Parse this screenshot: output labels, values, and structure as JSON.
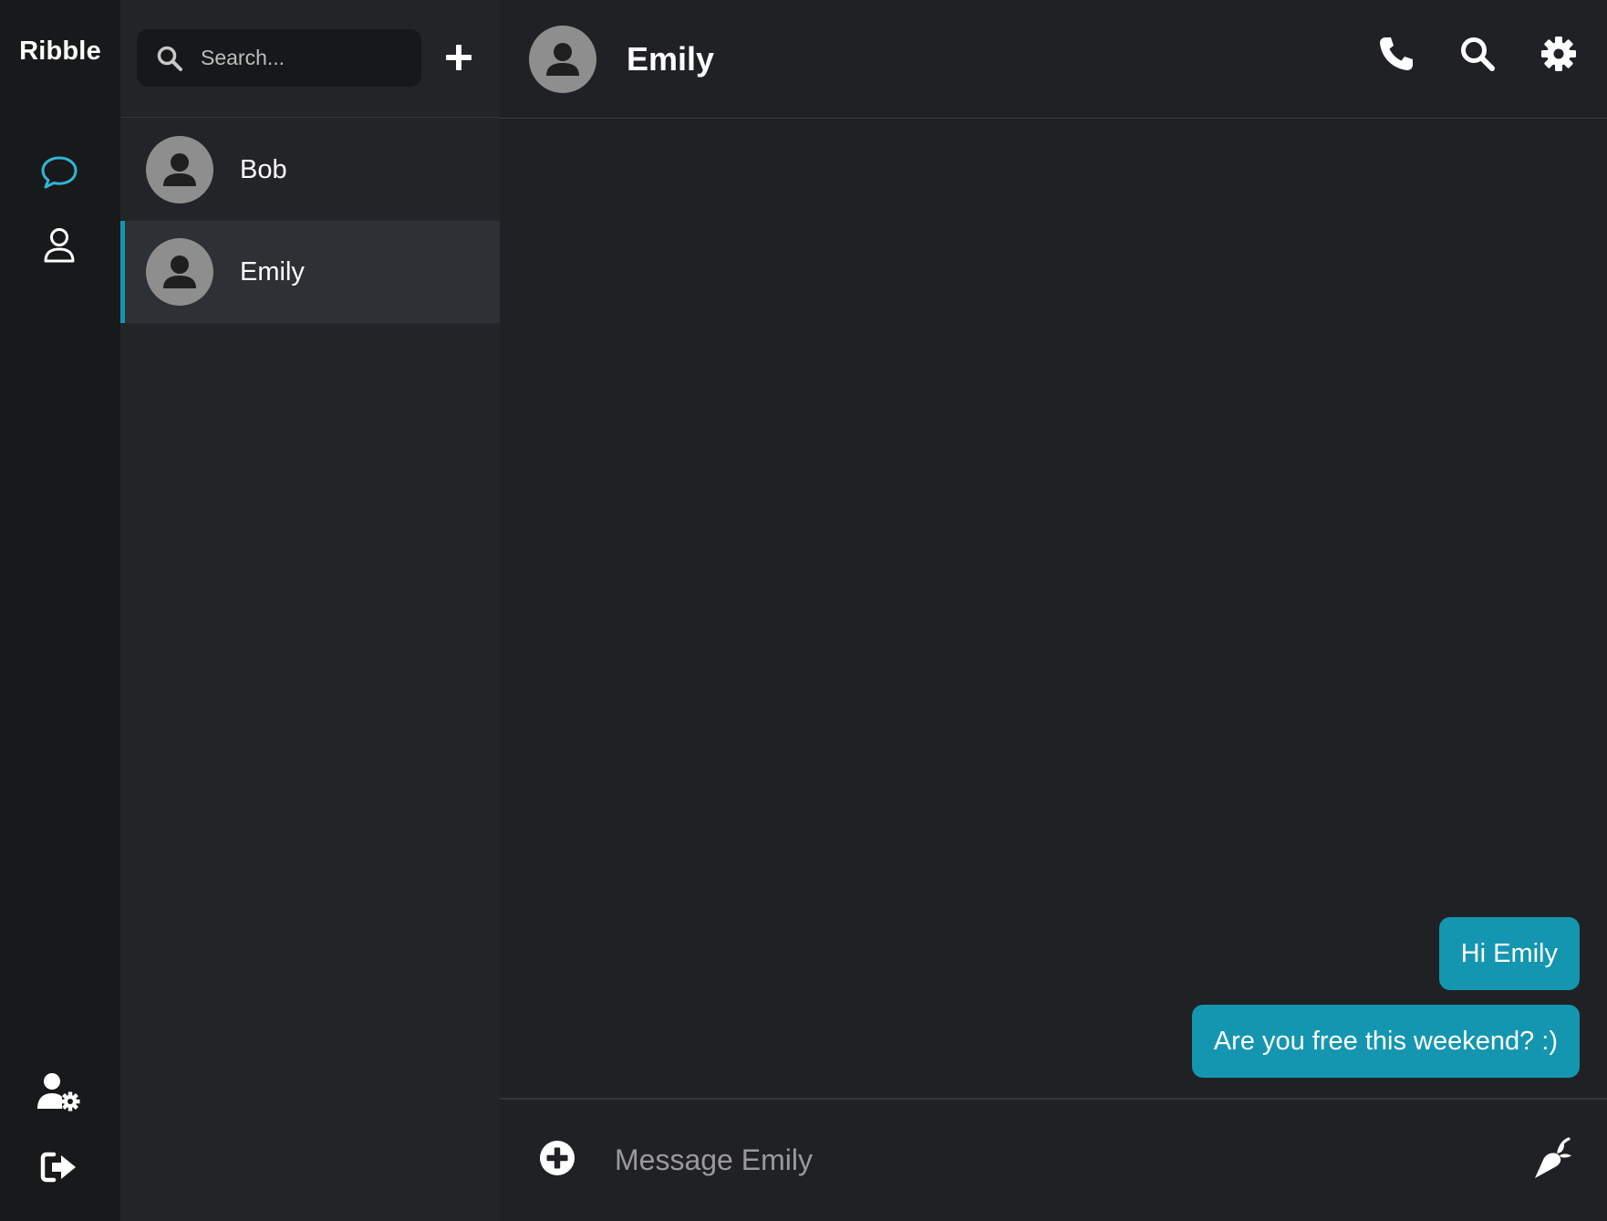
{
  "app": {
    "name": "Ribble"
  },
  "colors": {
    "accent": "#1596b0",
    "rail_bg": "#18191b",
    "list_bg": "#232427",
    "chat_bg": "#202124",
    "active_item_bg": "#2d3035"
  },
  "rail": {
    "top_items": [
      {
        "name": "chat-bubble-icon",
        "active": true
      },
      {
        "name": "user-icon",
        "active": false
      }
    ],
    "bottom_items": [
      {
        "name": "user-settings-icon"
      },
      {
        "name": "logout-icon"
      }
    ]
  },
  "search": {
    "placeholder": "Search...",
    "value": ""
  },
  "conversations": [
    {
      "name": "Bob",
      "active": false
    },
    {
      "name": "Emily",
      "active": true
    }
  ],
  "chat": {
    "title": "Emily",
    "header_actions": [
      "phone-icon",
      "search-icon",
      "gear-icon"
    ],
    "messages": [
      {
        "text": "Hi Emily",
        "outgoing": true
      },
      {
        "text": "Are you free this weekend? :)",
        "outgoing": true
      }
    ],
    "composer": {
      "placeholder": "Message Emily",
      "value": ""
    }
  }
}
